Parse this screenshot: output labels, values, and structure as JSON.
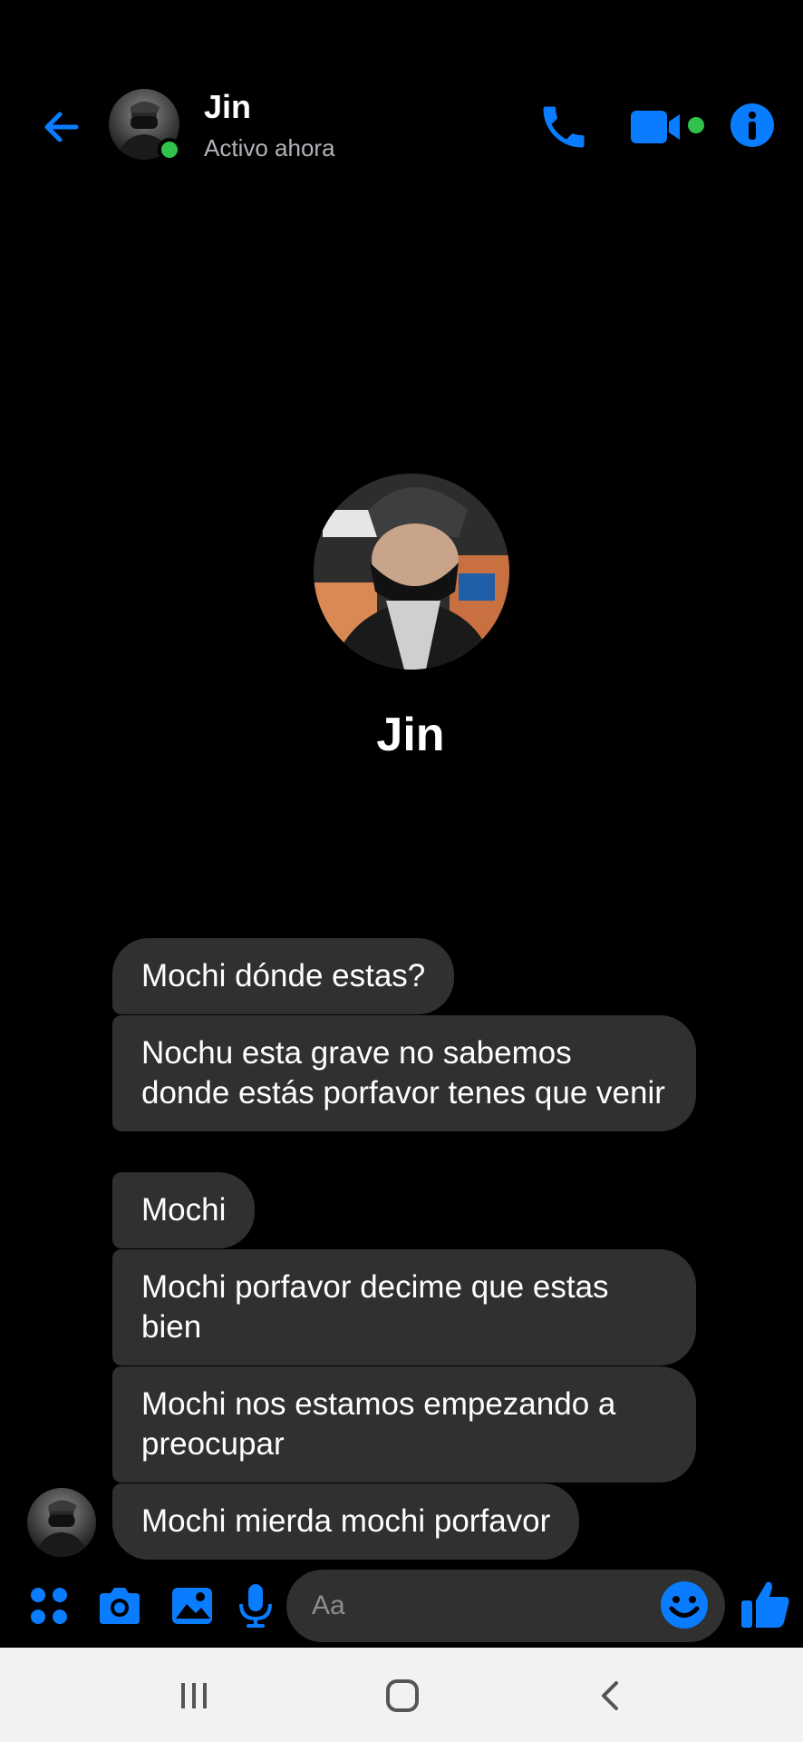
{
  "header": {
    "contact_name": "Jin",
    "status": "Activo ahora",
    "icons": [
      "back-arrow-icon",
      "phone-icon",
      "video-camera-icon",
      "info-icon"
    ]
  },
  "profile": {
    "name": "Jin"
  },
  "messages": [
    "Mochi dónde estas?",
    "Nochu esta grave no sabemos donde estás porfavor tenes que venir",
    "Mochi",
    "Mochi porfavor decime que estas bien",
    "Mochi nos estamos empezando a preocupar",
    "Mochi mierda mochi porfavor"
  ],
  "composer": {
    "placeholder": "Aa",
    "icons": [
      "apps-grid-icon",
      "camera-icon",
      "gallery-icon",
      "microphone-icon",
      "emoji-icon",
      "thumbs-up-icon"
    ]
  },
  "navbar": {
    "icons": [
      "recent-apps-icon",
      "home-icon",
      "back-icon"
    ]
  },
  "colors": {
    "accent": "#0a7cff",
    "online": "#31c24d",
    "bubble": "#303030",
    "background": "#000000",
    "navbar": "#f2f2f2"
  }
}
